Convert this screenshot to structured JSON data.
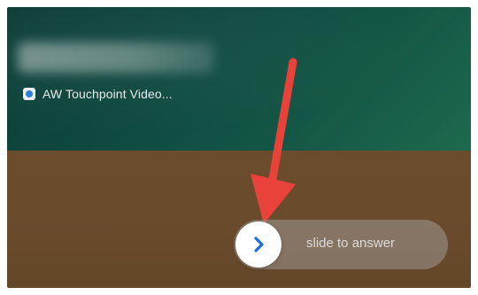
{
  "notification": {
    "app_name": "AW Touchpoint Video...",
    "app_icon": "video-app-icon"
  },
  "call": {
    "slide_label": "slide to answer",
    "knob_icon": "chevron-right-icon"
  },
  "colors": {
    "top_panel": "#0f4a40",
    "bottom_panel": "#6a4b2c",
    "arrow": "#e8423a",
    "knob_chevron": "#1f6fd6"
  }
}
